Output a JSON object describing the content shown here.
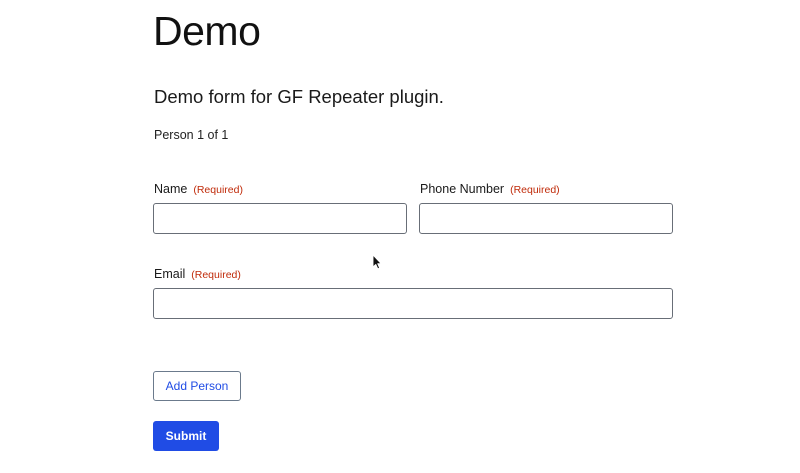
{
  "page": {
    "title": "Demo"
  },
  "form": {
    "description": "Demo form for GF Repeater plugin.",
    "page_counter": "Person 1 of 1",
    "required_text": "(Required)",
    "fields": {
      "name": {
        "label": "Name",
        "value": "",
        "placeholder": ""
      },
      "phone": {
        "label": "Phone Number",
        "value": "",
        "placeholder": ""
      },
      "email": {
        "label": "Email",
        "value": "",
        "placeholder": ""
      }
    },
    "add_label": "Add Person",
    "submit_label": "Submit"
  },
  "cursor": {
    "icon": "mouse-pointer-icon"
  },
  "colors": {
    "accent": "#204ce5",
    "required": "#c02b0a",
    "input_border": "#686e77"
  }
}
